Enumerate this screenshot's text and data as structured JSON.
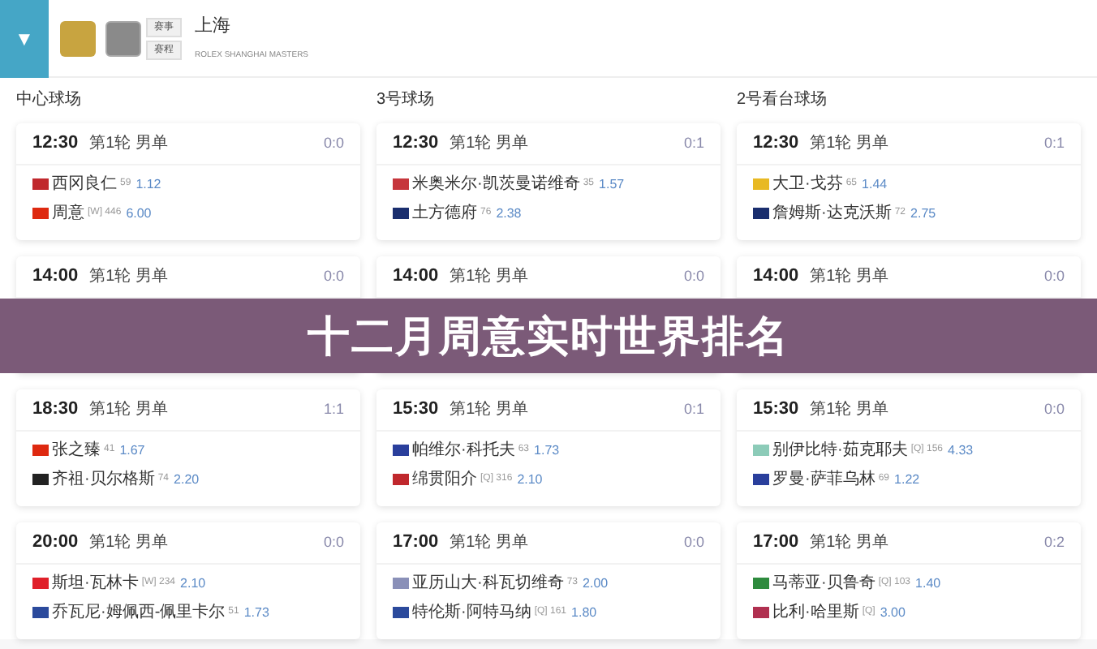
{
  "header": {
    "toggle": "▼",
    "buttons": [
      "赛事",
      "赛程"
    ],
    "title": "上海",
    "subtitle": "ROLEX SHANGHAI MASTERS"
  },
  "courts": [
    {
      "name": "中心球场",
      "matches": [
        {
          "time": "12:30",
          "round": "第1轮 男单",
          "score": "0:0",
          "players": [
            {
              "name": "西冈良仁",
              "color": "#c0282d",
              "rank": "59",
              "odds": "1.12"
            },
            {
              "name": "周意",
              "color": "#de2910",
              "rank": "[W] 446",
              "odds": "6.00"
            }
          ]
        },
        {
          "time": "14:00",
          "round": "第1轮 男单",
          "score": "0:0"
        },
        {
          "time": "18:30",
          "round": "第1轮 男单",
          "score": "1:1",
          "players": [
            {
              "name": "张之臻",
              "color": "#de2910",
              "rank": "41",
              "odds": "1.67"
            },
            {
              "name": "齐祖·贝尔格斯",
              "color": "#222222",
              "rank": "74",
              "odds": "2.20"
            }
          ]
        },
        {
          "time": "20:00",
          "round": "第1轮 男单",
          "score": "0:0",
          "players": [
            {
              "name": "斯坦·瓦林卡",
              "color": "#e0202a",
              "rank": "[W] 234",
              "odds": "2.10"
            },
            {
              "name": "乔瓦尼·姆佩西-佩里卡尔",
              "color": "#2b4a9c",
              "rank": "51",
              "odds": "1.73"
            }
          ]
        }
      ]
    },
    {
      "name": "3号球场",
      "matches": [
        {
          "time": "12:30",
          "round": "第1轮 男单",
          "score": "0:1",
          "players": [
            {
              "name": "米奥米尔·凯茨曼诺维奇",
              "color": "#c6363c",
              "rank": "35",
              "odds": "1.57"
            },
            {
              "name": "土方德府",
              "color": "#1a2e6e",
              "rank": "76",
              "odds": "2.38"
            }
          ]
        },
        {
          "time": "14:00",
          "round": "第1轮 男单",
          "score": "0:0"
        },
        {
          "time": "15:30",
          "round": "第1轮 男单",
          "score": "0:1",
          "players": [
            {
              "name": "帕维尔·科托夫",
              "color": "#2a3f9c",
              "rank": "63",
              "odds": "1.73"
            },
            {
              "name": "绵贯阳介",
              "color": "#c0282d",
              "rank": "[Q] 316",
              "odds": "2.10"
            }
          ]
        },
        {
          "time": "17:00",
          "round": "第1轮 男单",
          "score": "0:0",
          "players": [
            {
              "name": "亚历山大·科瓦切维奇",
              "color": "#8a90b8",
              "rank": "73",
              "odds": "2.00"
            },
            {
              "name": "特伦斯·阿特马纳",
              "color": "#2b4a9c",
              "rank": "[Q] 161",
              "odds": "1.80"
            }
          ]
        }
      ]
    },
    {
      "name": "2号看台球场",
      "matches": [
        {
          "time": "12:30",
          "round": "第1轮 男单",
          "score": "0:1",
          "players": [
            {
              "name": "大卫·戈芬",
              "color": "#e8b923",
              "rank": "65",
              "odds": "1.44"
            },
            {
              "name": "詹姆斯·达克沃斯",
              "color": "#1a2e6e",
              "rank": "72",
              "odds": "2.75"
            }
          ]
        },
        {
          "time": "14:00",
          "round": "第1轮 男单",
          "score": "0:0"
        },
        {
          "time": "15:30",
          "round": "第1轮 男单",
          "score": "0:0",
          "players": [
            {
              "name": "别伊比特·茹克耶夫",
              "color": "#8ccbb8",
              "rank": "[Q] 156",
              "odds": "4.33"
            },
            {
              "name": "罗曼·萨菲乌林",
              "color": "#2a3f9c",
              "rank": "69",
              "odds": "1.22"
            }
          ]
        },
        {
          "time": "17:00",
          "round": "第1轮 男单",
          "score": "0:2",
          "players": [
            {
              "name": "马蒂亚·贝鲁奇",
              "color": "#2e8b3e",
              "rank": "[Q] 103",
              "odds": "1.40"
            },
            {
              "name": "比利·哈里斯",
              "color": "#b03050",
              "rank": "[Q]",
              "odds": "3.00"
            }
          ]
        }
      ]
    }
  ],
  "banner": {
    "title": "十二月周意实时世界排名"
  }
}
